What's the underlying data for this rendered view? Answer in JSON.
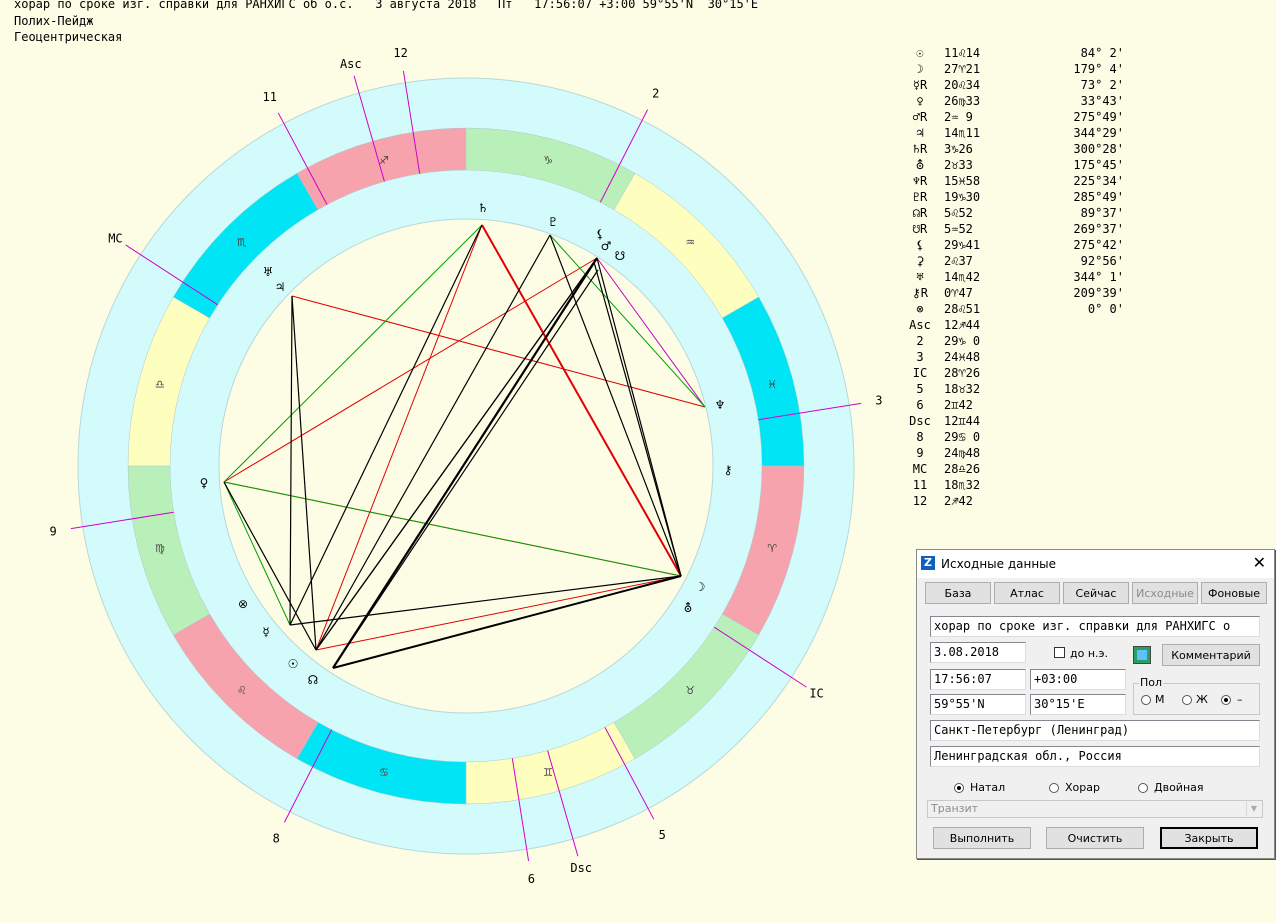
{
  "header": {
    "line1": "хорар по сроке изг. справки для РАНХИГС об о.с.   3 августа 2018   Пт   17:56:07 +3:00 59°55'N  30°15'E",
    "line2": "Полих-Пейдж",
    "line3": "Геоцентрическая"
  },
  "chart_labels": {
    "asc": "Asc",
    "dsc": "Dsc",
    "mc": "MC",
    "ic": "IC",
    "h2": "2",
    "h3": "3",
    "h5": "5",
    "h6": "6",
    "h8": "8",
    "h9": "9",
    "h11": "11",
    "h12": "12"
  },
  "signs": [
    "♈",
    "♉",
    "♊",
    "♋",
    "♌",
    "♍",
    "♎",
    "♏",
    "♐",
    "♑",
    "♒",
    "♓"
  ],
  "sign_colors": [
    "#f7a3ae",
    "#b9f0b9",
    "#fefebe",
    "#00e5f5"
  ],
  "planets": [
    {
      "symbol": "☉",
      "pos": "11♌14",
      "lon": "84° 2'"
    },
    {
      "symbol": "☽",
      "pos": "27♈21",
      "lon": "179° 4'"
    },
    {
      "symbol": "☿R",
      "pos": "20♌34",
      "lon": "73° 2'"
    },
    {
      "symbol": "♀",
      "pos": "26♍33",
      "lon": "33°43'"
    },
    {
      "symbol": "♂R",
      "pos": "2♒ 9",
      "lon": "275°49'"
    },
    {
      "symbol": "♃",
      "pos": "14♏11",
      "lon": "344°29'"
    },
    {
      "symbol": "♄R",
      "pos": "3♑26",
      "lon": "300°28'"
    },
    {
      "symbol": "⛢",
      "pos": "2♉33",
      "lon": "175°45'"
    },
    {
      "symbol": "♆R",
      "pos": "15♓58",
      "lon": "225°34'"
    },
    {
      "symbol": "♇R",
      "pos": "19♑30",
      "lon": "285°49'"
    },
    {
      "symbol": "☊R",
      "pos": "5♌52",
      "lon": "89°37'"
    },
    {
      "symbol": "☋R",
      "pos": "5♒52",
      "lon": "269°37'"
    },
    {
      "symbol": "⚸",
      "pos": "29♑41",
      "lon": "275°42'"
    },
    {
      "symbol": "⚳",
      "pos": "2♌37",
      "lon": "92°56'"
    },
    {
      "symbol": "♅",
      "pos": "14♏42",
      "lon": "344° 1'"
    },
    {
      "symbol": "⚷R",
      "pos": "0♈47",
      "lon": "209°39'"
    },
    {
      "symbol": "⊗",
      "pos": "28♌51",
      "lon": "0° 0'"
    },
    {
      "symbol": "Asc",
      "pos": "12♐44",
      "lon": ""
    },
    {
      "symbol": "2",
      "pos": "29♑ 0",
      "lon": ""
    },
    {
      "symbol": "3",
      "pos": "24♓48",
      "lon": ""
    },
    {
      "symbol": "IC",
      "pos": "28♈26",
      "lon": ""
    },
    {
      "symbol": "5",
      "pos": "18♉32",
      "lon": ""
    },
    {
      "symbol": "6",
      "pos": "2♊42",
      "lon": ""
    },
    {
      "symbol": "Dsc",
      "pos": "12♊44",
      "lon": ""
    },
    {
      "symbol": "8",
      "pos": "29♋ 0",
      "lon": ""
    },
    {
      "symbol": "9",
      "pos": "24♍48",
      "lon": ""
    },
    {
      "symbol": "MC",
      "pos": "28♎26",
      "lon": ""
    },
    {
      "symbol": "11",
      "pos": "18♏32",
      "lon": ""
    },
    {
      "symbol": "12",
      "pos": "2♐42",
      "lon": ""
    }
  ],
  "dialog": {
    "title": "Исходные данные",
    "buttons": {
      "base": "База",
      "atlas": "Атлас",
      "now": "Сейчас",
      "source": "Исходные",
      "background": "Фоновые"
    },
    "name": "хорар по сроке изг. справки для РАНХИГС о",
    "date": "3.08.2018",
    "bc_label": "до н.э.",
    "comment_label": "Комментарий",
    "time": "17:56:07",
    "tz": "+03:00",
    "lat": "59°55'N",
    "lon": "30°15'E",
    "sex_group": "Пол",
    "sex_m": "М",
    "sex_f": "Ж",
    "sex_none": "–",
    "city": "Санкт-Петербург (Ленинград)",
    "region": "Ленинградская обл., Россия",
    "mode_natal": "Натал",
    "mode_horar": "Хорар",
    "mode_double": "Двойная",
    "transit": "Транзит",
    "run": "Выполнить",
    "clear": "Очистить",
    "close": "Закрыть"
  }
}
